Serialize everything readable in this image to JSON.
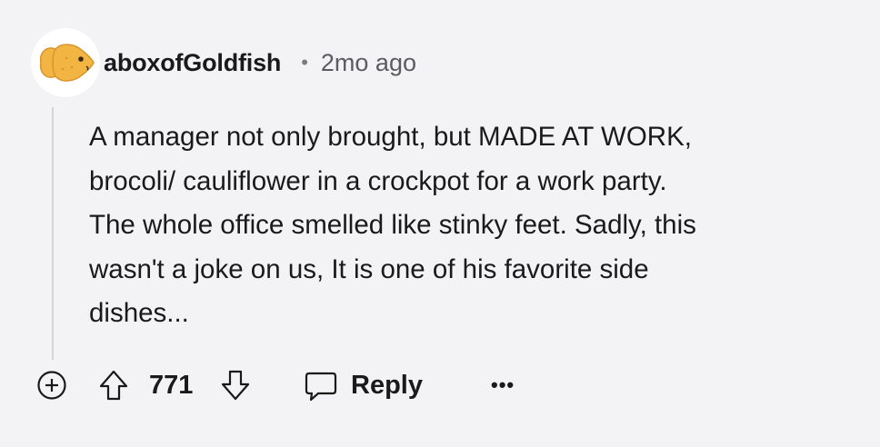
{
  "comment": {
    "author": "aboxofGoldfish",
    "separator": "•",
    "timestamp": "2mo ago",
    "body": "A manager not only brought, but MADE AT WORK,\nbrocoli/ cauliflower in a crockpot for a work party.\nThe whole office smelled like stinky feet. Sadly, this\nwasn't a joke on us, It is one of his favorite side\ndishes...",
    "avatar_icon": "goldfish-cracker-icon"
  },
  "actions": {
    "score": "771",
    "reply_label": "Reply",
    "more_label": "•••",
    "icons": {
      "expand": "plus-circle-icon",
      "upvote": "upvote-arrow-icon",
      "downvote": "downvote-arrow-icon",
      "reply": "speech-bubble-icon",
      "more": "ellipsis-icon"
    }
  },
  "colors": {
    "background": "#f3f3f5",
    "text": "#1a1a1b",
    "muted": "#5c5c60",
    "thread_line": "#d5d5d8",
    "avatar_fish": "#f2b543"
  }
}
